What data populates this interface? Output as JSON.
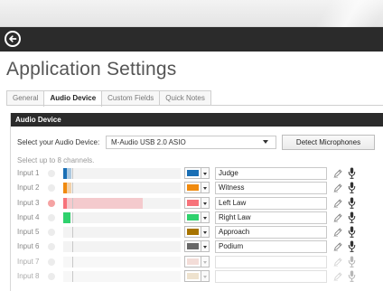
{
  "window": {
    "page_title": "Application Settings"
  },
  "tabs": [
    {
      "label": "General",
      "active": false
    },
    {
      "label": "Audio Device",
      "active": true
    },
    {
      "label": "Custom Fields",
      "active": false
    },
    {
      "label": "Quick Notes",
      "active": false
    }
  ],
  "panel": {
    "header": "Audio Device",
    "device_label": "Select your Audio Device:",
    "device_value": "M-Audio USB 2.0 ASIO",
    "detect_button": "Detect Microphones",
    "hint": "Select up to 8 channels."
  },
  "inputs": [
    {
      "label": "Input 1",
      "name": "Judge",
      "color": "#1a6fb5",
      "level": 0.03,
      "peak": 0.07,
      "active": false,
      "enabled": true
    },
    {
      "label": "Input 2",
      "name": "Witness",
      "color": "#f08a0e",
      "level": 0.03,
      "peak": 0.07,
      "active": false,
      "enabled": true
    },
    {
      "label": "Input 3",
      "name": "Left Law",
      "color": "#f7737b",
      "level": 0.03,
      "peak": 0.68,
      "active": true,
      "enabled": true
    },
    {
      "label": "Input 4",
      "name": "Right Law",
      "color": "#2fd16d",
      "level": 0.06,
      "peak": 0.06,
      "active": false,
      "enabled": true
    },
    {
      "label": "Input 5",
      "name": "Approach",
      "color": "#a87400",
      "level": 0,
      "peak": 0,
      "active": false,
      "enabled": true
    },
    {
      "label": "Input 6",
      "name": "Podium",
      "color": "#686868",
      "level": 0,
      "peak": 0,
      "active": false,
      "enabled": true
    },
    {
      "label": "Input 7",
      "name": "",
      "color": "#e5b4a8",
      "level": 0,
      "peak": 0,
      "active": false,
      "enabled": false
    },
    {
      "label": "Input 8",
      "name": "",
      "color": "#d9bf93",
      "level": 0,
      "peak": 0,
      "active": false,
      "enabled": false
    }
  ],
  "icons": {
    "back": "back-arrow-circle-icon",
    "edit": "pencil-edit-icon",
    "mic": "microphone-icon",
    "dropdown": "chevron-down-icon"
  }
}
